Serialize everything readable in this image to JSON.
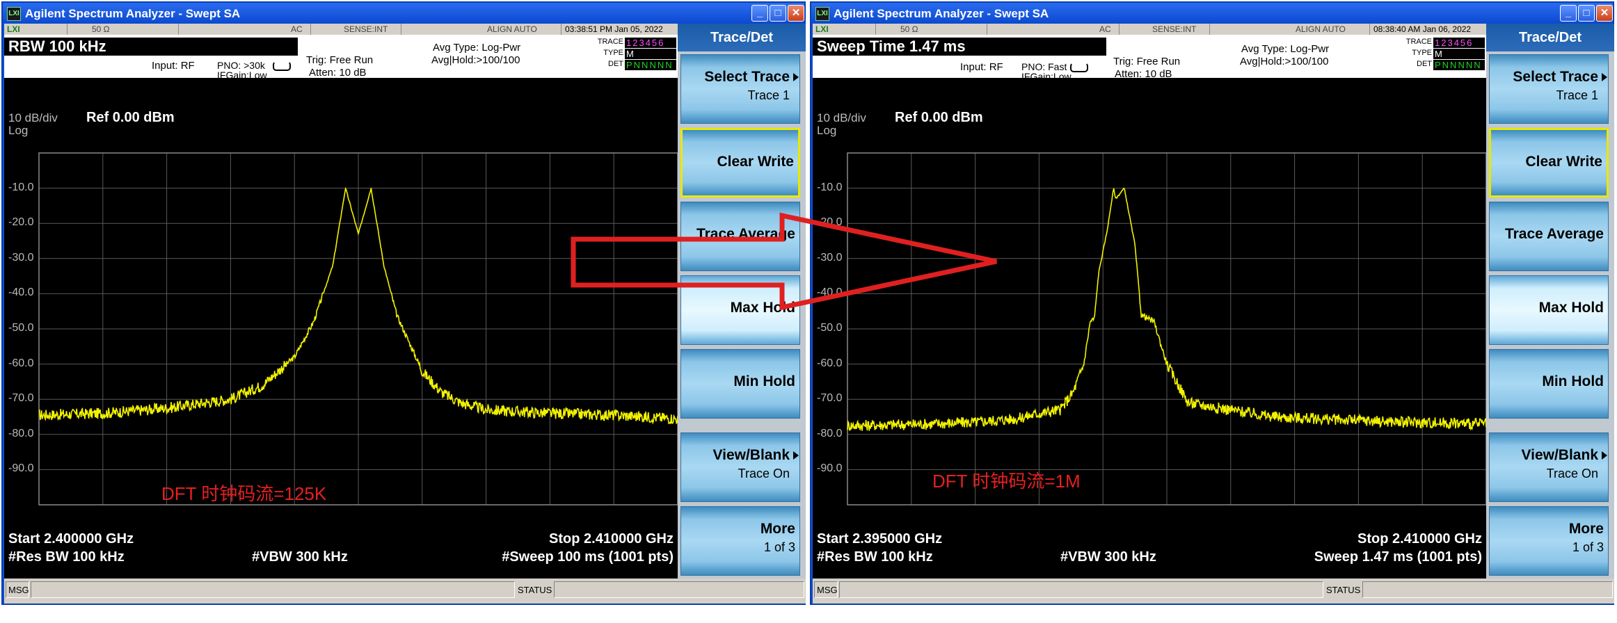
{
  "windows": [
    {
      "title": "Agilent Spectrum Analyzer - Swept SA",
      "strip": {
        "impedance": "50 Ω",
        "coupling": "AC",
        "sense": "SENSE:INT",
        "align": "ALIGN AUTO",
        "datetime": "03:38:51 PM Jan 05, 2022"
      },
      "info": {
        "active_param": "RBW  100 kHz",
        "input": "Input: RF",
        "pno": "PNO: >30k",
        "ifgain": "IFGain:Low",
        "trig": "Trig: Free Run",
        "atten": "Atten: 10 dB",
        "avg_type": "Avg Type: Log-Pwr",
        "avg_hold": "Avg|Hold:>100/100",
        "trace_label": "TRACE",
        "type_label": "TYPE",
        "det_label": "DET",
        "trace_row": "123456",
        "type_row": "M",
        "det_row": "PNNNNN"
      },
      "display": {
        "scale": "10 dB/div",
        "ref": "Ref 0.00 dBm",
        "log": "Log"
      },
      "y_ticks": [
        "-10.0",
        "-20.0",
        "-30.0",
        "-40.0",
        "-50.0",
        "-60.0",
        "-70.0",
        "-80.0",
        "-90.0"
      ],
      "bottom": {
        "start": "Start 2.400000 GHz",
        "stop": "Stop 2.410000 GHz",
        "res_bw": "#Res BW 100 kHz",
        "vbw": "#VBW 300 kHz",
        "sweep": "#Sweep  100 ms (1001 pts)"
      },
      "annotation": "DFT 时钟码流=125K",
      "softkeys": {
        "header": "Trace/Det",
        "items": [
          {
            "label": "Select Trace",
            "sub": "Trace 1"
          },
          {
            "label": "Clear Write",
            "sub": ""
          },
          {
            "label": "Trace Average",
            "sub": ""
          },
          {
            "label": "Max Hold",
            "sub": ""
          },
          {
            "label": "Min Hold",
            "sub": ""
          },
          {
            "label": "View/Blank",
            "sub": "Trace On"
          },
          {
            "label": "More",
            "sub": "1 of 3"
          }
        ]
      },
      "msgbar": {
        "msg": "MSG",
        "status": "STATUS"
      },
      "chart_data": {
        "type": "line",
        "title": "",
        "xlabel": "",
        "ylabel": "",
        "xlim": [
          2.4,
          2.41
        ],
        "ylim": [
          -100,
          0
        ],
        "x_unit": "GHz",
        "y_unit": "dBm",
        "series": [
          {
            "x": [
              2.4,
              2.401,
              2.402,
              2.403,
              2.4035,
              2.404,
              2.4043,
              2.4046,
              2.4048,
              2.405,
              2.4052,
              2.4054,
              2.4056,
              2.406,
              2.4063,
              2.4066,
              2.407,
              2.408,
              2.409,
              2.41
            ],
            "y": [
              -74.5,
              -74,
              -72.5,
              -70,
              -66,
              -58,
              -48,
              -32,
              -10,
              -23,
              -10,
              -32,
              -46,
              -62,
              -68,
              -71,
              -73,
              -74,
              -74.5,
              -75.5
            ]
          }
        ]
      }
    },
    {
      "title": "Agilent Spectrum Analyzer - Swept SA",
      "strip": {
        "impedance": "50 Ω",
        "coupling": "AC",
        "sense": "SENSE:INT",
        "align": "ALIGN AUTO",
        "datetime": "08:38:40 AM Jan 06, 2022"
      },
      "info": {
        "active_param": "Sweep Time  1.47 ms",
        "input": "Input: RF",
        "pno": "PNO: Fast",
        "ifgain": "IFGain:Low",
        "trig": "Trig: Free Run",
        "atten": "Atten: 10 dB",
        "avg_type": "Avg Type: Log-Pwr",
        "avg_hold": "Avg|Hold:>100/100",
        "trace_label": "TRACE",
        "type_label": "TYPE",
        "det_label": "DET",
        "trace_row": "123456",
        "type_row": "M",
        "det_row": "PNNNNN"
      },
      "display": {
        "scale": "10 dB/div",
        "ref": "Ref 0.00 dBm",
        "log": "Log"
      },
      "y_ticks": [
        "-10.0",
        "-20.0",
        "-30.0",
        "-40.0",
        "-50.0",
        "-60.0",
        "-70.0",
        "-80.0",
        "-90.0"
      ],
      "bottom": {
        "start": "Start 2.395000 GHz",
        "stop": "Stop 2.410000 GHz",
        "res_bw": "#Res BW 100 kHz",
        "vbw": "#VBW 300 kHz",
        "sweep": "Sweep  1.47 ms (1001 pts)"
      },
      "annotation": "DFT 时钟码流=1M",
      "softkeys": {
        "header": "Trace/Det",
        "items": [
          {
            "label": "Select Trace",
            "sub": "Trace 1"
          },
          {
            "label": "Clear Write",
            "sub": ""
          },
          {
            "label": "Trace Average",
            "sub": ""
          },
          {
            "label": "Max Hold",
            "sub": ""
          },
          {
            "label": "Min Hold",
            "sub": ""
          },
          {
            "label": "View/Blank",
            "sub": "Trace On"
          },
          {
            "label": "More",
            "sub": "1 of 3"
          }
        ]
      },
      "msgbar": {
        "msg": "MSG",
        "status": "STATUS"
      },
      "chart_data": {
        "type": "line",
        "title": "",
        "xlabel": "",
        "ylabel": "",
        "xlim": [
          2.395,
          2.41
        ],
        "ylim": [
          -100,
          0
        ],
        "x_unit": "GHz",
        "y_unit": "dBm",
        "series": [
          {
            "x": [
              2.395,
              2.397,
              2.398,
              2.3985,
              2.399,
              2.3995,
              2.4,
              2.4003,
              2.40055,
              2.4007,
              2.4008,
              2.4009,
              2.4011,
              2.40125,
              2.4013,
              2.4015,
              2.40175,
              2.4019,
              2.4022,
              2.4025,
              2.403,
              2.405,
              2.408,
              2.41
            ],
            "y": [
              -77.5,
              -77,
              -76.5,
              -76,
              -75.5,
              -74,
              -73,
              -68,
              -60,
              -48,
              -47,
              -34,
              -22,
              -10,
              -13,
              -10,
              -26,
              -46,
              -48,
              -60,
              -71,
              -75,
              -76.5,
              -77
            ]
          }
        ]
      }
    }
  ]
}
